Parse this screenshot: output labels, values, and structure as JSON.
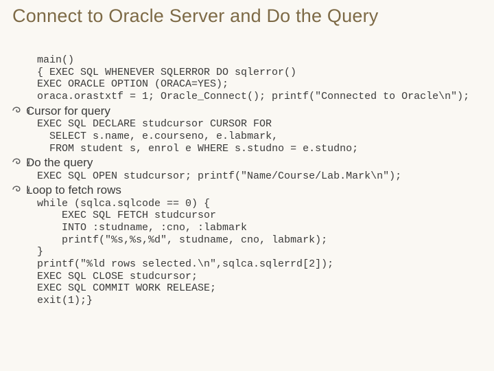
{
  "title": "Connect to Oracle Server and Do the Query",
  "codeIntro": "main()\n{ EXEC SQL WHENEVER SQLERROR DO sqlerror()\nEXEC ORACLE OPTION (ORACA=YES);\noraca.orastxtf = 1; Oracle_Connect(); printf(\"Connected to Oracle\\n\");",
  "sections": [
    {
      "heading": "Cursor for query",
      "code": "EXEC SQL DECLARE studcursor CURSOR FOR\n  SELECT s.name, e.courseno, e.labmark,\n  FROM student s, enrol e WHERE s.studno = e.studno;"
    },
    {
      "heading": "Do the query",
      "code": "EXEC SQL OPEN studcursor; printf(\"Name/Course/Lab.Mark\\n\");"
    },
    {
      "heading": "Loop to fetch rows",
      "code": "while (sqlca.sqlcode == 0) {\n    EXEC SQL FETCH studcursor\n    INTO :studname, :cno, :labmark\n    printf(\"%s,%s,%d\", studname, cno, labmark);\n}\nprintf(\"%ld rows selected.\\n\",sqlca.sqlerrd[2]);\nEXEC SQL CLOSE studcursor;\nEXEC SQL COMMIT WORK RELEASE;\nexit(1);}"
    }
  ]
}
